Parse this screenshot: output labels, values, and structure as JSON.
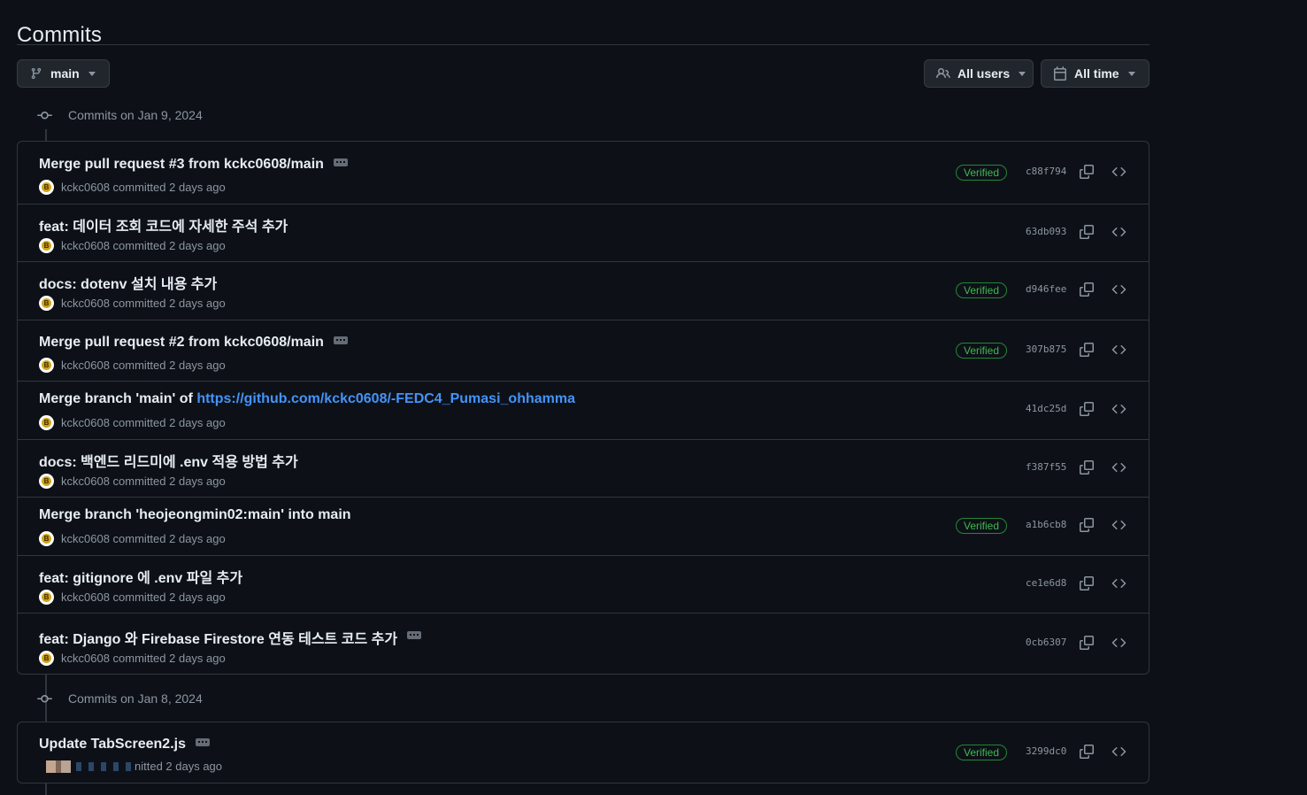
{
  "page": {
    "title": "Commits"
  },
  "toolbar": {
    "branch": "main",
    "users": "All users",
    "time": "All time"
  },
  "groups": [
    {
      "header": "Commits on Jan 9, 2024",
      "commits": [
        {
          "message": "Merge pull request #3 from kckc0608/main",
          "has_more": true,
          "author": "kckc0608",
          "meta": "committed 2 days ago",
          "verified": "Verified",
          "sha": "c88f794"
        },
        {
          "message": "feat: 데이터 조회 코드에 자세한 주석 추가",
          "has_more": false,
          "author": "kckc0608",
          "meta": "committed 2 days ago",
          "verified": "",
          "sha": "63db093"
        },
        {
          "message": "docs: dotenv 설치 내용 추가",
          "has_more": false,
          "author": "kckc0608",
          "meta": "committed 2 days ago",
          "verified": "Verified",
          "sha": "d946fee"
        },
        {
          "message": "Merge pull request #2 from kckc0608/main",
          "has_more": true,
          "author": "kckc0608",
          "meta": "committed 2 days ago",
          "verified": "Verified",
          "sha": "307b875"
        },
        {
          "message_prefix": "Merge branch 'main' of ",
          "message_link": "https://github.com/kckc0608/-FEDC4_Pumasi_ohhamma",
          "has_more": false,
          "author": "kckc0608",
          "meta": "committed 2 days ago",
          "verified": "",
          "sha": "41dc25d"
        },
        {
          "message": "docs: 백엔드 리드미에 .env 적용 방법 추가",
          "has_more": false,
          "author": "kckc0608",
          "meta": "committed 2 days ago",
          "verified": "",
          "sha": "f387f55"
        },
        {
          "message": "Merge branch 'heojeongmin02:main' into main",
          "has_more": false,
          "author": "kckc0608",
          "meta": "committed 2 days ago",
          "verified": "Verified",
          "sha": "a1b6cb8"
        },
        {
          "message": "feat: gitignore 에 .env 파일 추가",
          "has_more": false,
          "author": "kckc0608",
          "meta": "committed 2 days ago",
          "verified": "",
          "sha": "ce1e6d8"
        },
        {
          "message": "feat: Django 와 Firebase Firestore 연동 테스트 코드 추가",
          "has_more": true,
          "author": "kckc0608",
          "meta": "committed 2 days ago",
          "verified": "",
          "sha": "0cb6307"
        }
      ]
    },
    {
      "header": "Commits on Jan 8, 2024",
      "commits": [
        {
          "message": "Update TabScreen2.js",
          "has_more": true,
          "meta_partial": "nitted 2 days ago",
          "verified": "Verified",
          "sha": "3299dc0"
        }
      ]
    }
  ],
  "colors": {
    "background": "#0d1117",
    "border": "#30363d",
    "link": "#4493f8",
    "verified": "#3fb950",
    "muted": "#8d96a0"
  },
  "icons": [
    "git-branch-icon",
    "people-icon",
    "calendar-icon",
    "caret-down-icon",
    "git-commit-icon",
    "copy-icon",
    "code-icon",
    "kebab-horizontal-icon"
  ]
}
